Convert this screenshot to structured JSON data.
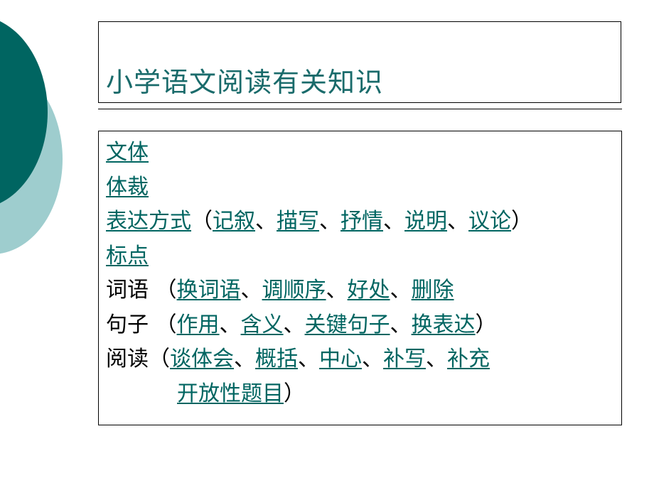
{
  "slide": {
    "title": "小学语文阅读有关知识",
    "colors": {
      "accent_dark": "#006561",
      "accent_light": "#9ecdce",
      "title_text": "#1a6b6b",
      "link_text": "#006561"
    }
  },
  "content": {
    "line1": {
      "link": "文体"
    },
    "line2": {
      "link": "体裁"
    },
    "line3": {
      "link": "表达方式",
      "open": "（",
      "items": [
        "记叙",
        "描写",
        "抒情",
        "说明",
        "议论"
      ],
      "sep": "、",
      "close": "）"
    },
    "line4": {
      "link": "标点"
    },
    "line5": {
      "label": "词语",
      "open": " （",
      "items": [
        "换词语",
        "调顺序",
        "好处",
        "删除"
      ],
      "sep": "、"
    },
    "line6": {
      "label": "句子",
      "open": " （",
      "items": [
        "作用",
        "含义",
        "关键句子",
        "换表达"
      ],
      "sep": "、",
      "close": "）"
    },
    "line7": {
      "label": "阅读",
      "open": "（",
      "items": [
        "谈体会",
        "概括",
        "中心",
        "补写",
        "补充"
      ],
      "sep": "、"
    },
    "line8": {
      "items": [
        "开放性题目"
      ],
      "close": "）"
    }
  }
}
